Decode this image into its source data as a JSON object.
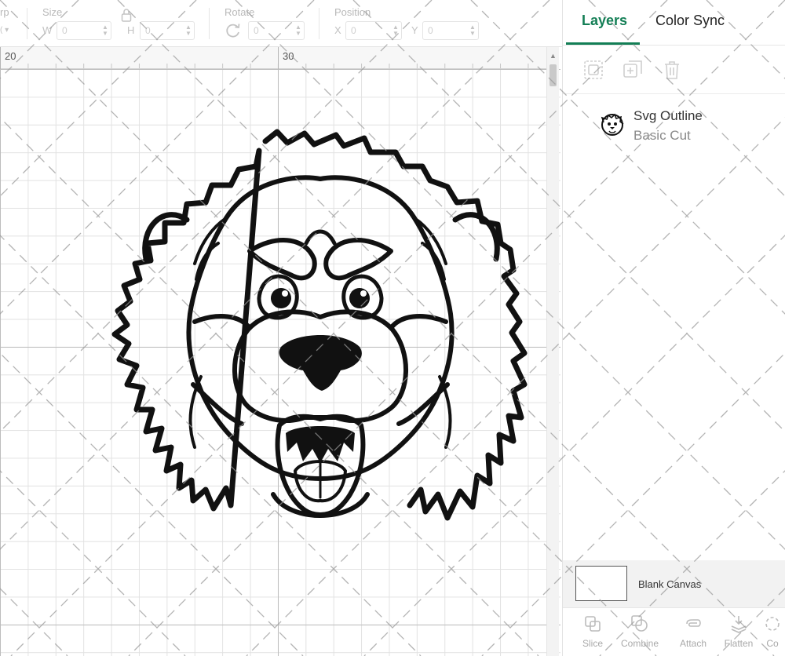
{
  "toolbar": {
    "warp_label": "rp",
    "size_label": "Size",
    "width_letter": "W",
    "width_value": "0",
    "height_letter": "H",
    "height_value": "0",
    "rotate_label": "Rotate",
    "rotate_value": "0",
    "position_label": "Position",
    "x_letter": "X",
    "x_value": "0",
    "y_letter": "Y",
    "y_value": "0"
  },
  "ruler": {
    "labels": [
      "20",
      "30"
    ]
  },
  "panel": {
    "tabs": [
      {
        "label": "Layers",
        "active": true
      },
      {
        "label": "Color Sync",
        "active": false
      }
    ],
    "layers": [
      {
        "name": "Svg Outline",
        "type": "Basic Cut"
      }
    ],
    "blank_canvas_label": "Blank Canvas",
    "bottom_actions": [
      {
        "label": "Slice",
        "icon": "slice-icon"
      },
      {
        "label": "Combine",
        "icon": "combine-icon"
      },
      {
        "label": "Attach",
        "icon": "attach-icon"
      },
      {
        "label": "Flatten",
        "icon": "flatten-icon"
      },
      {
        "label": "Co",
        "icon": "contour-icon"
      }
    ]
  },
  "colors": {
    "accent": "#137e55",
    "outline": "#111111"
  }
}
